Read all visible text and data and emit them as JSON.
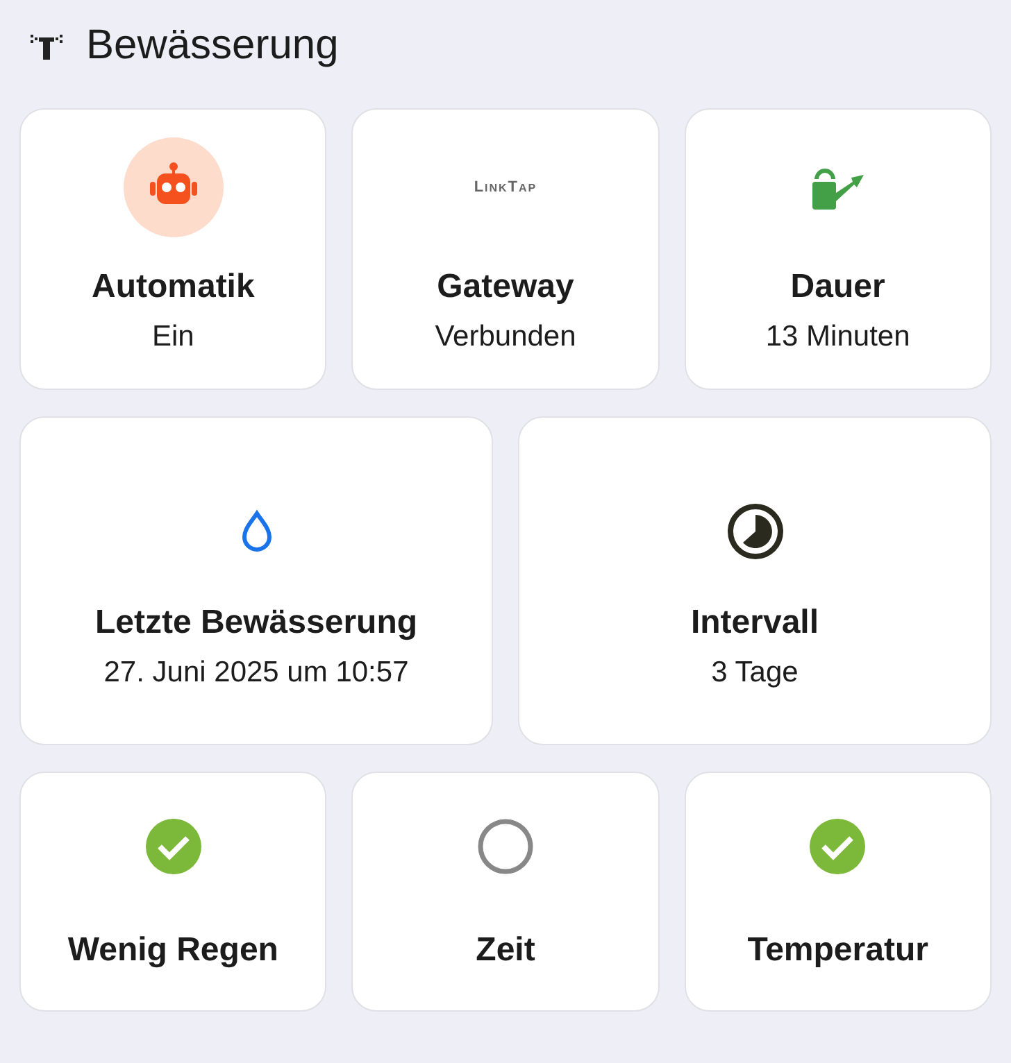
{
  "header": {
    "title": "Bewässerung"
  },
  "rows": [
    [
      {
        "kind": "robot",
        "active": true,
        "title": "Automatik",
        "value": "Ein"
      },
      {
        "kind": "logo",
        "logo": "LinkTap",
        "title": "Gateway",
        "value": "Verbunden"
      },
      {
        "kind": "watering-can",
        "title": "Dauer",
        "value": "13 Minuten"
      }
    ],
    [
      {
        "kind": "drop",
        "title": "Letzte Bewässerung",
        "value": "27. Juni 2025 um 10:57"
      },
      {
        "kind": "timer",
        "title": "Intervall",
        "value": "3 Tage"
      }
    ],
    [
      {
        "kind": "condition",
        "checked": true,
        "title": "Wenig Regen"
      },
      {
        "kind": "condition",
        "checked": false,
        "title": "Zeit"
      },
      {
        "kind": "condition",
        "checked": true,
        "title": "Temperatur"
      }
    ]
  ]
}
